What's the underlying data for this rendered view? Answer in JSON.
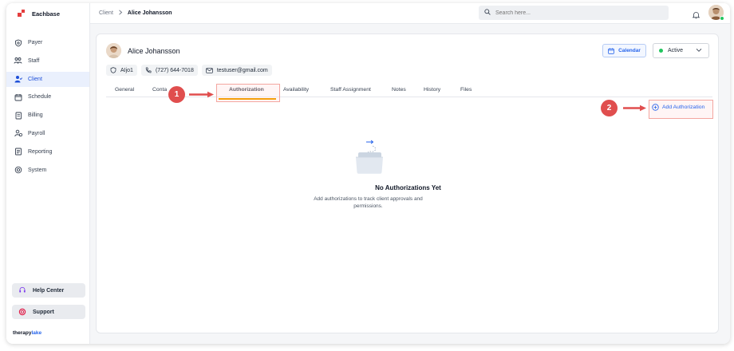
{
  "app": {
    "name": "Eachbase"
  },
  "sidebar": {
    "items": [
      {
        "label": "Payer",
        "icon": "shield-icon"
      },
      {
        "label": "Staff",
        "icon": "staff-icon"
      },
      {
        "label": "Client",
        "icon": "client-icon",
        "active": true
      },
      {
        "label": "Schedule",
        "icon": "calendar-icon"
      },
      {
        "label": "Billing",
        "icon": "billing-icon"
      },
      {
        "label": "Payroll",
        "icon": "payroll-icon"
      },
      {
        "label": "Reporting",
        "icon": "reporting-icon"
      },
      {
        "label": "System",
        "icon": "system-icon"
      }
    ],
    "help_center": "Help Center",
    "support": "Support",
    "footer_logo_dark": "therapy",
    "footer_logo_accent": "lake"
  },
  "topbar": {
    "breadcrumb_parent": "Client",
    "breadcrumb_current": "Alice Johansson",
    "search_placeholder": "Search here..."
  },
  "client": {
    "name": "Alice Johansson",
    "id": "AIjo1",
    "phone": "(727) 644-7018",
    "email": "testuser@gmail.com",
    "calendar_label": "Calendar",
    "status": "Active"
  },
  "tabs": [
    {
      "label": "General"
    },
    {
      "label": "Conta"
    },
    {
      "label": "Authorization",
      "active": true
    },
    {
      "label": "Availability"
    },
    {
      "label": "Staff Assignment"
    },
    {
      "label": "Notes"
    },
    {
      "label": "History"
    },
    {
      "label": "Files"
    }
  ],
  "add_authorization_label": "Add Authorization",
  "empty_state": {
    "title": "No Authorizations Yet",
    "description": "Add authorizations to track client approvals and permissions."
  },
  "annotations": {
    "step1": "1",
    "step2": "2"
  },
  "colors": {
    "accent": "#2563eb",
    "active_tab_underline": "#f59e0b",
    "annotation": "#e04e4e",
    "status_active": "#22c55e"
  }
}
